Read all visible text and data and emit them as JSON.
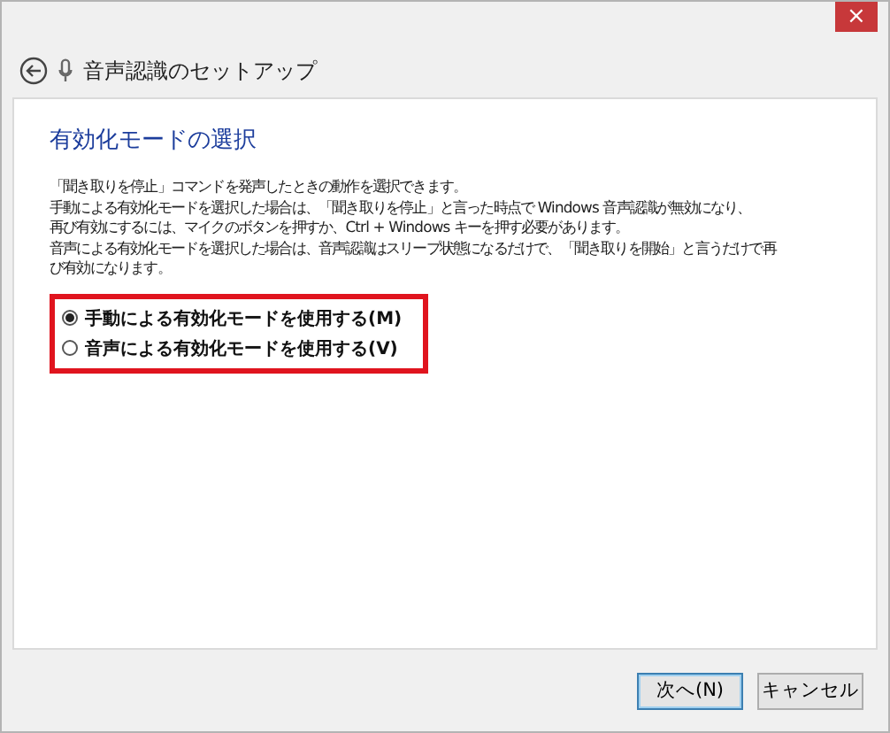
{
  "window": {
    "close": "×",
    "title": "音声認識のセットアップ"
  },
  "page": {
    "heading": "有効化モードの選択",
    "lines": [
      "「聞き取りを停止」コマンドを発声したときの動作を選択できます。",
      "手動による有効化モードを選択した場合は、「聞き取りを停止」と言った時点で Windows 音声認識が無効になり、",
      "再び有効にするには、マイクのボタンを押すか、Ctrl + Windows キーを押す必要があります。",
      "音声による有効化モードを選択した場合は、音声認識はスリープ状態になるだけで、「聞き取りを開始」と言うだけで再",
      "び有効になります。"
    ],
    "options": [
      {
        "label": "手動による有効化モードを使用する(M)",
        "selected": true
      },
      {
        "label": "音声による有効化モードを使用する(V)",
        "selected": false
      }
    ]
  },
  "buttons": [
    {
      "label": "次へ(N)",
      "default": true
    },
    {
      "label": "キャンセル",
      "default": false
    }
  ]
}
